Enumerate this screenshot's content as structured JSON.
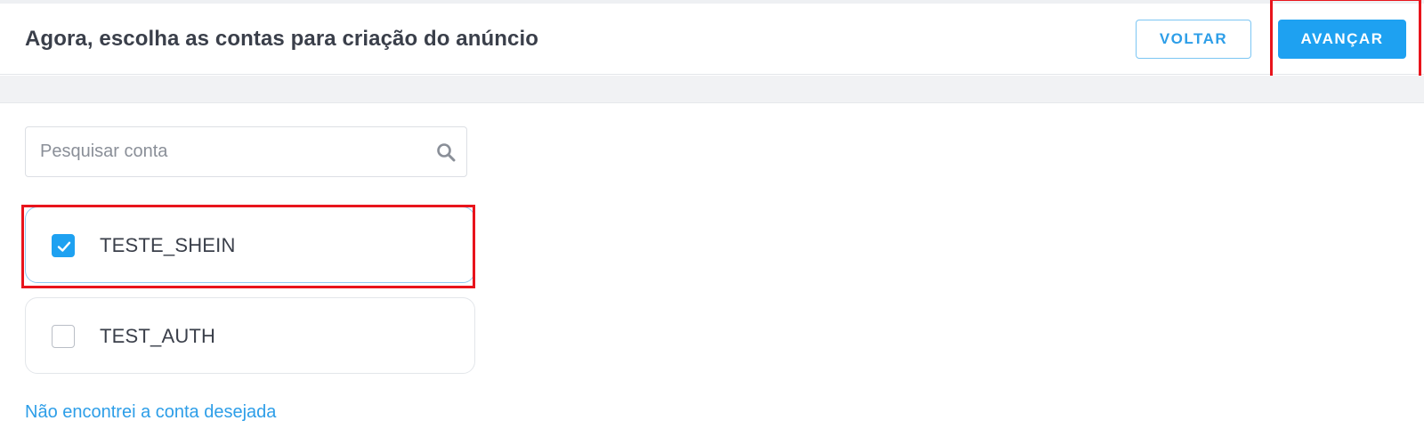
{
  "header": {
    "title": "Agora, escolha as contas para criação do anúncio",
    "back_label": "VOLTAR",
    "next_label": "AVANÇAR"
  },
  "search": {
    "placeholder": "Pesquisar conta",
    "value": "",
    "icon": "search-icon"
  },
  "accounts": [
    {
      "label": "TESTE_SHEIN",
      "checked": true
    },
    {
      "label": "TEST_AUTH",
      "checked": false
    }
  ],
  "footer": {
    "link_label": "Não encontrei a conta desejada"
  },
  "colors": {
    "accent": "#1ea1f1",
    "highlight": "#e8141c",
    "link": "#2d9ee8"
  }
}
